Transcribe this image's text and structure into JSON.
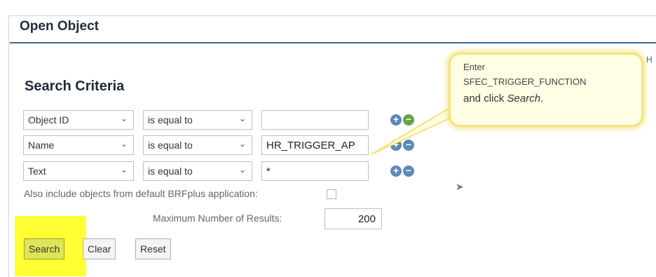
{
  "window": {
    "title": "Open Object",
    "help_link": "H"
  },
  "section": {
    "title": "Search Criteria"
  },
  "criteria_rows": [
    {
      "field": "Object ID",
      "operator": "is equal to",
      "value": ""
    },
    {
      "field": "Name",
      "operator": "is equal to",
      "value": "HR_TRIGGER_AP"
    },
    {
      "field": "Text",
      "operator": "is equal to",
      "value": "*"
    }
  ],
  "options": {
    "include_default_label": "Also include objects from default BRFplus application:",
    "max_results_label": "Maximum Number of Results:",
    "max_results_value": "200"
  },
  "buttons": {
    "search": "Search",
    "clear": "Clear",
    "reset": "Reset"
  },
  "callout": {
    "line1": "Enter",
    "line2": "SFEC_TRIGGER_FUNCTION",
    "line3_prefix": "and click ",
    "line3_action": "Search",
    "line3_suffix": "."
  },
  "icons": {
    "add": "plus-circle-icon",
    "remove": "minus-circle-icon",
    "dropdown": "chevron-down-icon"
  },
  "colors": {
    "highlight": "#ffff33",
    "title_rule": "#3d6a8f",
    "search_button": "#dfe55a",
    "callout_border": "#f2e57a"
  }
}
